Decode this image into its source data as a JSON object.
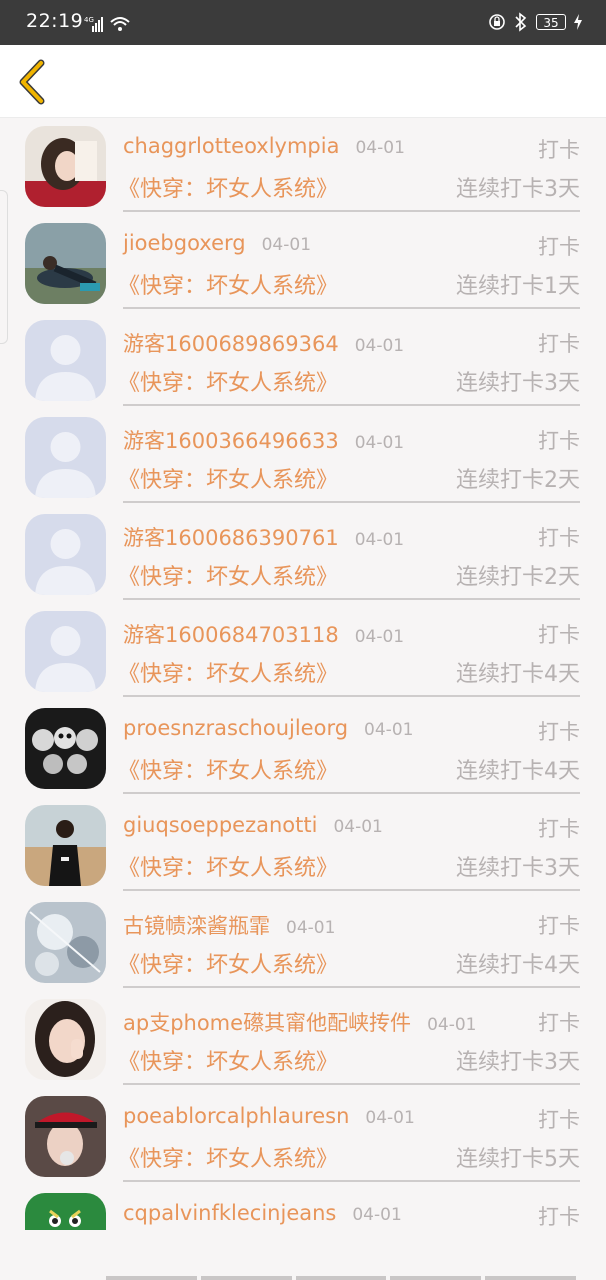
{
  "status": {
    "time": "22:19",
    "network": "4G",
    "battery": "35",
    "colors": {
      "bar": "#3b3b3b"
    }
  },
  "header": {
    "back_icon": "chevron-left-icon",
    "back_color": "#f0b400"
  },
  "colors": {
    "accent": "#e8955a",
    "muted": "#b7b2b2"
  },
  "rows": [
    {
      "name": "",
      "date": "",
      "checkin": "",
      "book": "《快穿：坏女人系统》",
      "streak": "连续打卡2天",
      "avatar": "default"
    },
    {
      "name": "chaggrlotteoxlympia",
      "date": "04-01",
      "checkin": "打卡",
      "book": "《快穿：坏女人系统》",
      "streak": "连续打卡3天",
      "avatar": "photo-girl"
    },
    {
      "name": "jioebgoxerg",
      "date": "04-01",
      "checkin": "打卡",
      "book": "《快穿：坏女人系统》",
      "streak": "连续打卡1天",
      "avatar": "photo-yoga"
    },
    {
      "name": "游客1600689869364",
      "date": "04-01",
      "checkin": "打卡",
      "book": "《快穿：坏女人系统》",
      "streak": "连续打卡3天",
      "avatar": "default"
    },
    {
      "name": "游客1600366496633",
      "date": "04-01",
      "checkin": "打卡",
      "book": "《快穿：坏女人系统》",
      "streak": "连续打卡2天",
      "avatar": "default"
    },
    {
      "name": "游客1600686390761",
      "date": "04-01",
      "checkin": "打卡",
      "book": "《快穿：坏女人系统》",
      "streak": "连续打卡2天",
      "avatar": "default"
    },
    {
      "name": "游客1600684703118",
      "date": "04-01",
      "checkin": "打卡",
      "book": "《快穿：坏女人系统》",
      "streak": "连续打卡4天",
      "avatar": "default"
    },
    {
      "name": "proesnzraschoujleorg",
      "date": "04-01",
      "checkin": "打卡",
      "book": "《快穿：坏女人系统》",
      "streak": "连续打卡4天",
      "avatar": "photo-skulls"
    },
    {
      "name": "giuqsoeppezanotti",
      "date": "04-01",
      "checkin": "打卡",
      "book": "《快穿：坏女人系统》",
      "streak": "连续打卡3天",
      "avatar": "photo-beach"
    },
    {
      "name": "古镜帻滦酱瓶霏",
      "date": "04-01",
      "checkin": "打卡",
      "book": "《快穿：坏女人系统》",
      "streak": "连续打卡4天",
      "avatar": "photo-ice"
    },
    {
      "name": "ap支phome礤其甯他配峡抟件",
      "date": "04-01",
      "checkin": "打卡",
      "book": "《快穿：坏女人系统》",
      "streak": "连续打卡3天",
      "avatar": "photo-selfie"
    },
    {
      "name": "poeablorcalphlauresn",
      "date": "04-01",
      "checkin": "打卡",
      "book": "《快穿：坏女人系统》",
      "streak": "连续打卡5天",
      "avatar": "photo-cap"
    },
    {
      "name": "cqpalvinfklecinjeans",
      "date": "04-01",
      "checkin": "打卡",
      "book": "",
      "streak": "",
      "avatar": "photo-green"
    }
  ]
}
